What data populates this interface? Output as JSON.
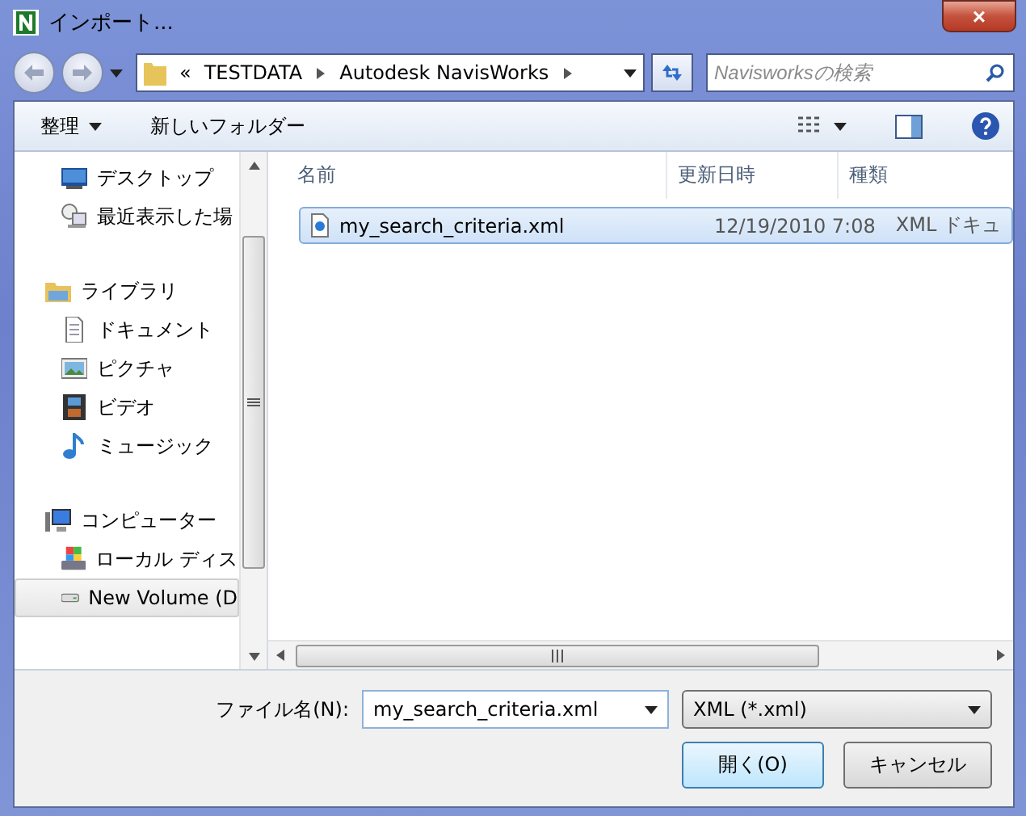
{
  "window": {
    "title": "インポート...",
    "close": "×"
  },
  "address": {
    "overflow": "«",
    "crumbs": [
      "TESTDATA",
      "Autodesk NavisWorks"
    ]
  },
  "search": {
    "placeholder": "Navisworksの検索"
  },
  "toolbar": {
    "organize": "整理",
    "new_folder": "新しいフォルダー"
  },
  "sidebar": {
    "sections": [
      {
        "children": [
          {
            "label": "デスクトップ",
            "selected": false
          },
          {
            "label": "最近表示した場",
            "selected": false
          }
        ]
      },
      {
        "label": "ライブラリ",
        "children": [
          {
            "label": "ドキュメント",
            "selected": false
          },
          {
            "label": "ピクチャ",
            "selected": false
          },
          {
            "label": "ビデオ",
            "selected": false
          },
          {
            "label": "ミュージック",
            "selected": false
          }
        ]
      },
      {
        "label": "コンピューター",
        "children": [
          {
            "label": "ローカル ディス",
            "selected": false
          },
          {
            "label": "New Volume (D",
            "selected": true
          }
        ]
      }
    ]
  },
  "table": {
    "columns": [
      "名前",
      "更新日時",
      "種類"
    ],
    "rows": [
      {
        "name": "my_search_criteria.xml",
        "modified": "12/19/2010 7:08",
        "type": "XML ドキュ",
        "selected": true
      }
    ]
  },
  "footer": {
    "filename_label": "ファイル名(N):",
    "filename": "my_search_criteria.xml",
    "filter": "XML (*.xml)",
    "buttons": [
      {
        "label": "開く(O)",
        "default": true
      },
      {
        "label": "キャンセル",
        "default": false
      }
    ]
  }
}
